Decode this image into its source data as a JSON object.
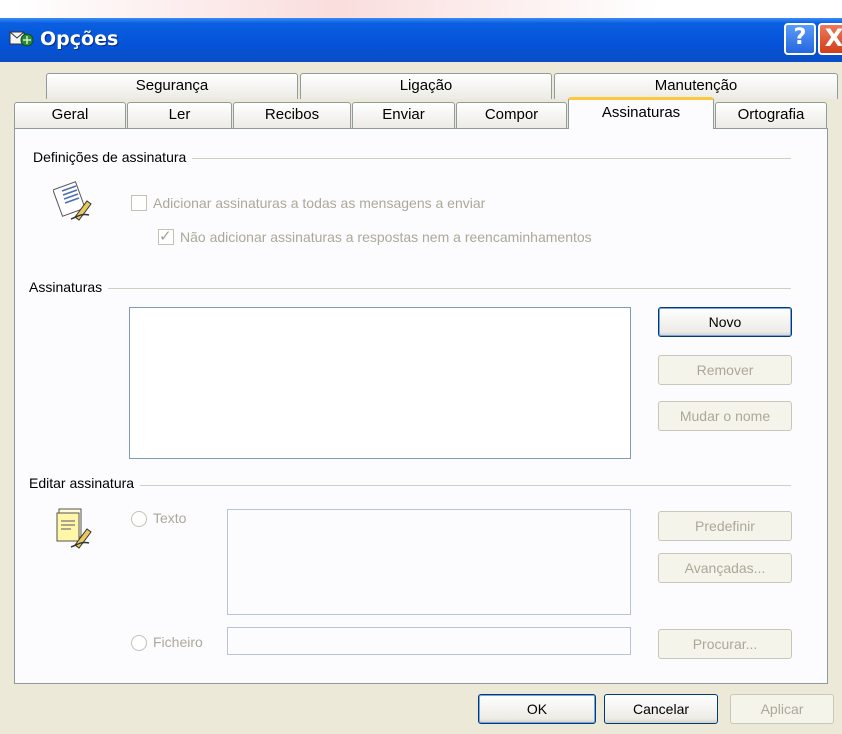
{
  "window": {
    "title": "Opções"
  },
  "titlebar_buttons": {
    "help": "?",
    "close": "X"
  },
  "tabs_row1": [
    "Segurança",
    "Ligação",
    "Manutenção"
  ],
  "tabs_row2": [
    "Geral",
    "Ler",
    "Recibos",
    "Enviar",
    "Compor",
    "Assinaturas",
    "Ortografia"
  ],
  "active_tab": "Assinaturas",
  "settings": {
    "group_label": "Definições de assinatura",
    "add_all": {
      "label": "Adicionar assinaturas a todas as mensagens a enviar",
      "checked": false
    },
    "no_replies": {
      "label": "Não adicionar assinaturas a respostas nem a reencaminhamentos",
      "checked": true,
      "mark": "✓"
    }
  },
  "signatures": {
    "group_label": "Assinaturas",
    "new_button": "Novo",
    "remove_button": "Remover",
    "rename_button": "Mudar o nome"
  },
  "edit": {
    "group_label": "Editar assinatura",
    "text_radio": "Texto",
    "file_radio": "Ficheiro",
    "default_button": "Predefinir",
    "advanced_button": "Avançadas...",
    "browse_button": "Procurar..."
  },
  "footer": {
    "ok": "OK",
    "cancel": "Cancelar",
    "apply": "Aplicar"
  }
}
